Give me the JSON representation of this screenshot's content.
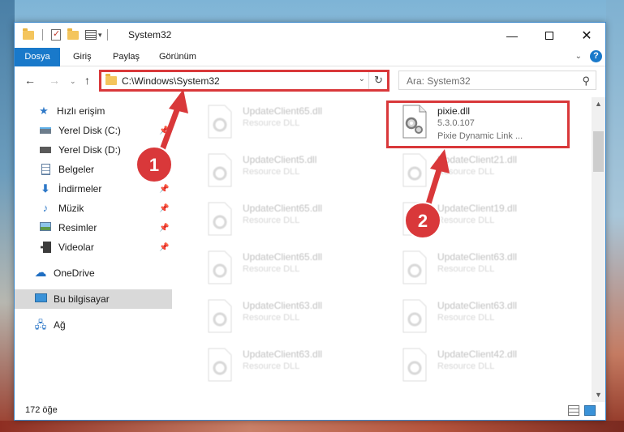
{
  "window": {
    "title": "System32"
  },
  "ribbon": {
    "tabs": [
      "Dosya",
      "Giriş",
      "Paylaş",
      "Görünüm"
    ]
  },
  "nav": {
    "address": "C:\\Windows\\System32",
    "search_placeholder": "Ara: System32"
  },
  "sidebar": {
    "items": [
      {
        "label": "Hızlı erişim",
        "icon": "star-icon"
      },
      {
        "label": "Yerel Disk (C:)",
        "icon": "drive-icon"
      },
      {
        "label": "Yerel Disk (D:)",
        "icon": "drive-icon"
      },
      {
        "label": "Belgeler",
        "icon": "documents-icon"
      },
      {
        "label": "İndirmeler",
        "icon": "download-icon"
      },
      {
        "label": "Müzik",
        "icon": "music-icon"
      },
      {
        "label": "Resimler",
        "icon": "pictures-icon"
      },
      {
        "label": "Videolar",
        "icon": "video-icon"
      },
      {
        "label": "OneDrive",
        "icon": "cloud-icon"
      },
      {
        "label": "Bu bilgisayar",
        "icon": "computer-icon"
      },
      {
        "label": "Ağ",
        "icon": "network-icon"
      }
    ]
  },
  "files": {
    "left_column": [
      {
        "name": "UpdateClient65.dll",
        "desc": "Resource DLL"
      },
      {
        "name": "UpdateClient5.dll",
        "desc": "Resource DLL"
      },
      {
        "name": "UpdateClient65.dll",
        "desc": "Resource DLL"
      },
      {
        "name": "UpdateClient65.dll",
        "desc": "Resource DLL"
      },
      {
        "name": "UpdateClient63.dll",
        "desc": "Resource DLL"
      },
      {
        "name": "UpdateClient63.dll",
        "desc": "Resource DLL"
      }
    ],
    "highlighted": {
      "name": "pixie.dll",
      "version": "5.3.0.107",
      "desc": "Pixie Dynamic Link ..."
    },
    "right_column": [
      {
        "name": "UpdateClient21.dll",
        "desc": "Resource DLL"
      },
      {
        "name": "UpdateClient19.dll",
        "desc": "Resource DLL"
      },
      {
        "name": "UpdateClient63.dll",
        "desc": "Resource DLL"
      },
      {
        "name": "UpdateClient63.dll",
        "desc": "Resource DLL"
      },
      {
        "name": "UpdateClient42.dll",
        "desc": "Resource DLL"
      }
    ]
  },
  "status": {
    "item_count": "172 öğe"
  },
  "annotations": {
    "step1": "1",
    "step2": "2",
    "color": "#d9383a"
  }
}
